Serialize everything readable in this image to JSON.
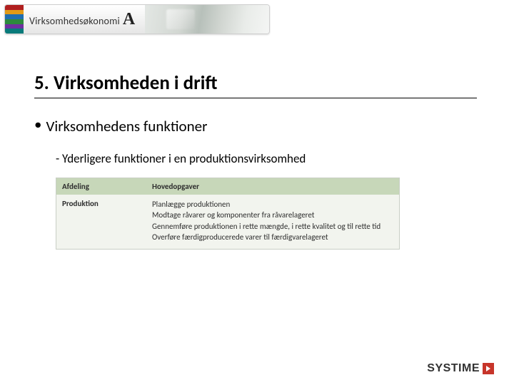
{
  "banner": {
    "brand_name": "Virksomhedsøkonomi",
    "brand_letter": "A",
    "stripe_colors": [
      "#b01f1f",
      "#e29a16",
      "#1f6eb0",
      "#2c8a3d",
      "#6f2fa0",
      "#087a7a"
    ]
  },
  "slide": {
    "title": "5. Virksomheden i drift",
    "bullet1": "Virksomhedens funktioner",
    "bullet2": "- Yderligere funktioner i en produktionsvirksomhed"
  },
  "table": {
    "header_col1": "Afdeling",
    "header_col2": "Hovedopgaver",
    "row_label": "Produktion",
    "tasks": [
      "Planlægge produktionen",
      "Modtage råvarer og komponenter fra råvarelageret",
      "Gennemføre produktionen i rette mængde, i rette kvalitet og til rette tid",
      "Overføre færdigproducerede varer til færdigvarelageret"
    ]
  },
  "footer": {
    "brand": "SYSTIME"
  }
}
